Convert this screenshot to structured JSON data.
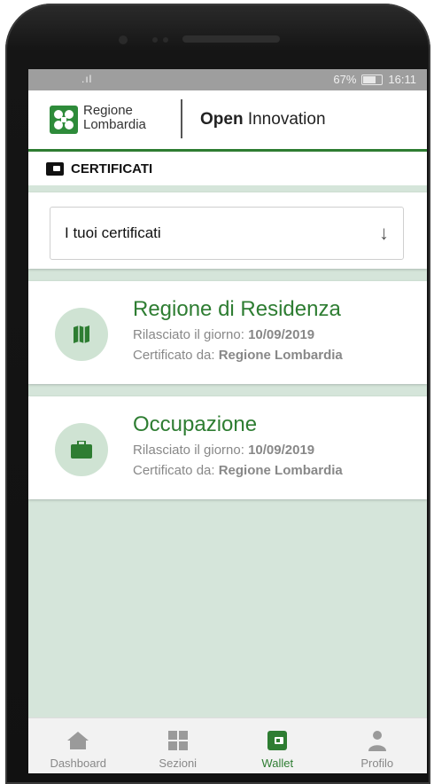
{
  "statusbar": {
    "signal": ".ıl",
    "battery": "67%",
    "time": "16:11"
  },
  "header": {
    "logo_line1": "Regione",
    "logo_line2": "Lombardia",
    "brand_bold": "Open",
    "brand_rest": " Innovation"
  },
  "section": {
    "title": "CERTIFICATI"
  },
  "select": {
    "label": "I tuoi certificati",
    "arrow": "↓"
  },
  "certificates": [
    {
      "title": "Regione di Residenza",
      "issued_prefix": "Rilasciato il giorno: ",
      "issued_date": "10/09/2019",
      "by_prefix": "Certificato da: ",
      "by": "Regione Lombardia",
      "icon": "map-icon"
    },
    {
      "title": "Occupazione",
      "issued_prefix": "Rilasciato il giorno: ",
      "issued_date": "10/09/2019",
      "by_prefix": "Certificato da: ",
      "by": "Regione Lombardia",
      "icon": "briefcase-icon"
    }
  ],
  "nav": [
    {
      "label": "Dashboard",
      "icon": "home-icon",
      "active": false
    },
    {
      "label": "Sezioni",
      "icon": "grid-icon",
      "active": false
    },
    {
      "label": "Wallet",
      "icon": "wallet-icon",
      "active": true
    },
    {
      "label": "Profilo",
      "icon": "person-icon",
      "active": false
    }
  ],
  "colors": {
    "accent": "#2e7d32",
    "background": "#d5e5da",
    "icon_circle": "#cfe3d3"
  }
}
